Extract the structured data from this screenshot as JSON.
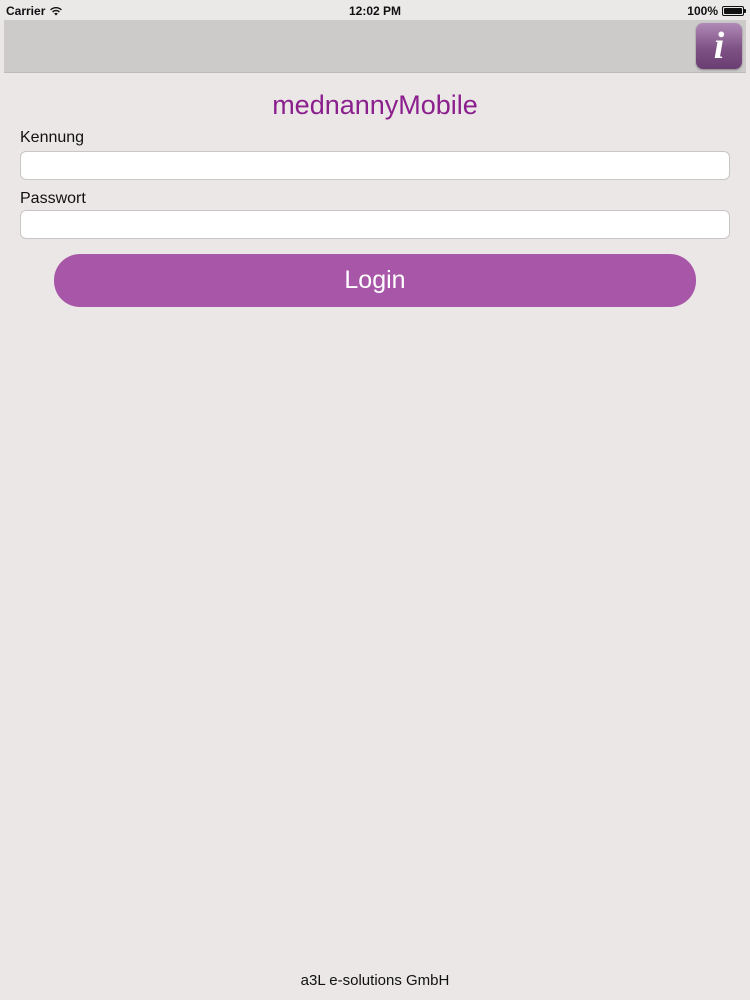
{
  "status_bar": {
    "carrier": "Carrier",
    "time": "12:02 PM",
    "battery": "100%",
    "battery_level": 1.0
  },
  "toolbar": {
    "info_icon": "info-icon",
    "info_glyph": "i"
  },
  "app_title": "mednannyMobile",
  "form": {
    "kennung_label": "Kennung",
    "kennung_value": "",
    "passwort_label": "Passwort",
    "passwort_value": "",
    "login_label": "Login"
  },
  "footer": "a3L e-solutions GmbH",
  "colors": {
    "accent": "#a857a8",
    "title": "#8b1f8d",
    "background": "#ebe7e7",
    "toolbar": "#cdcbca"
  }
}
